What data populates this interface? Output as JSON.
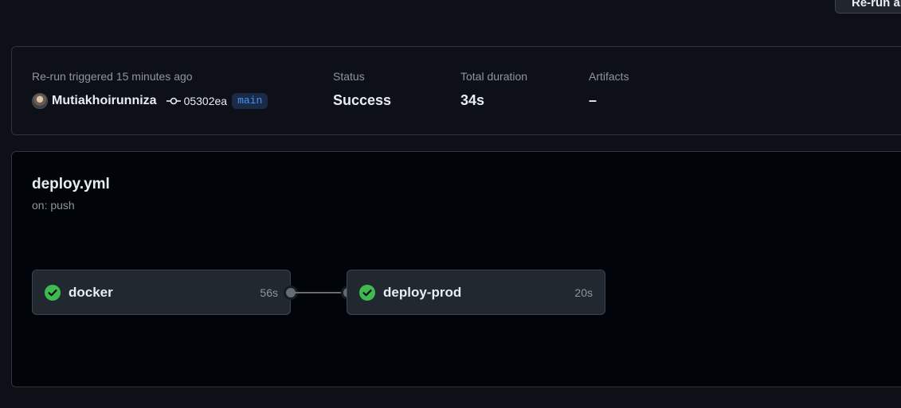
{
  "header": {
    "rerun_button_label": "Re-run all jobs"
  },
  "summary": {
    "trigger_text": "Re-run triggered 15 minutes ago",
    "actor": "Mutiakhoirunniza",
    "commit_sha": "05302ea",
    "branch": "main",
    "status_label": "Status",
    "status_value": "Success",
    "duration_label": "Total duration",
    "duration_value": "34s",
    "artifacts_label": "Artifacts",
    "artifacts_value": "–"
  },
  "workflow": {
    "file_name": "deploy.yml",
    "trigger": "on: push",
    "jobs": [
      {
        "name": "docker",
        "duration": "56s",
        "status": "success"
      },
      {
        "name": "deploy-prod",
        "duration": "20s",
        "status": "success"
      }
    ]
  },
  "colors": {
    "success": "#3fb950",
    "accent": "#4493f8",
    "background": "#0d1117"
  },
  "icons": {
    "commit": "git-commit-icon",
    "job_status": "check-circle-icon"
  }
}
